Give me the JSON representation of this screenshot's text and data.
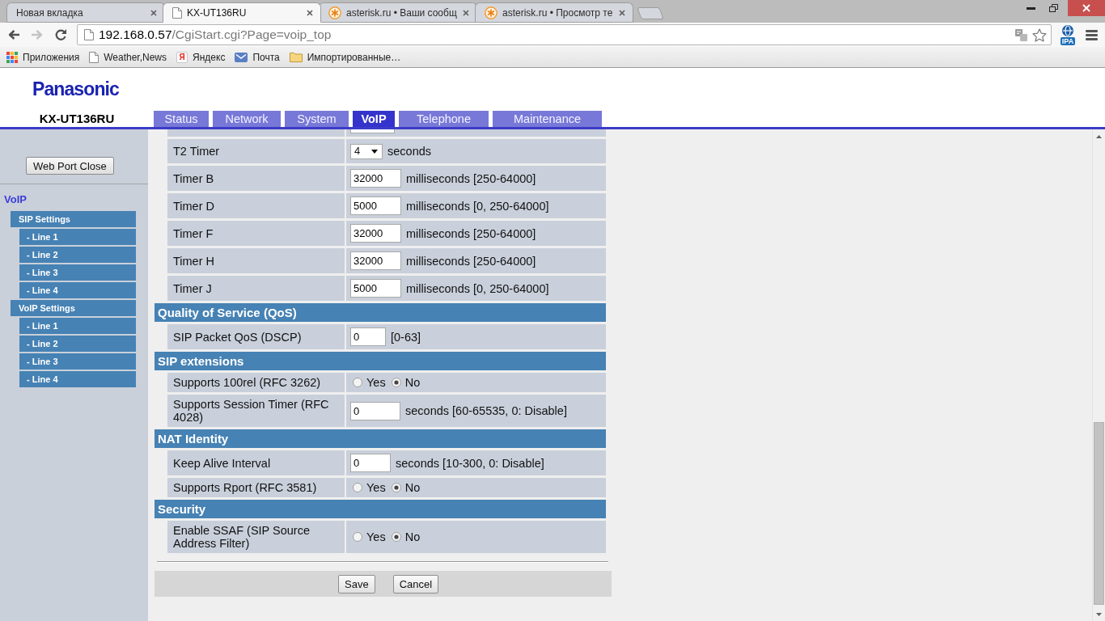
{
  "browser": {
    "tabs": [
      {
        "title": "Новая вкладка",
        "selected": false
      },
      {
        "title": "KX-UT136RU",
        "selected": true
      },
      {
        "title": "asterisk.ru • Ваши сообщ",
        "selected": false
      },
      {
        "title": "asterisk.ru • Просмотр те",
        "selected": false
      }
    ],
    "nav": [
      {
        "kind": "back",
        "disabled": false
      },
      {
        "kind": "forward",
        "disabled": true
      },
      {
        "kind": "reload",
        "disabled": false
      }
    ],
    "address": {
      "host": "192.168.0.57",
      "path": "/CgiStart.cgi?Page=voip_top"
    },
    "extension": {
      "label": "IPA"
    },
    "bookmarks": [
      {
        "label": "Приложения"
      },
      {
        "label": "Weather,News"
      },
      {
        "label": "Яндекс",
        "glyph": "Я"
      },
      {
        "label": "Почта"
      },
      {
        "label": "Импортированные…"
      }
    ]
  },
  "header": {
    "logo": "Panasonic",
    "model": "KX-UT136RU",
    "tabs": [
      {
        "label": "Status",
        "selected": false
      },
      {
        "label": "Network",
        "selected": false
      },
      {
        "label": "System",
        "selected": false
      },
      {
        "label": "VoIP",
        "selected": true
      },
      {
        "label": "Telephone",
        "selected": false
      },
      {
        "label": "Maintenance",
        "selected": false
      }
    ]
  },
  "sidebar": {
    "button": "Web Port Close",
    "title": "VoIP",
    "items": [
      {
        "label": "SIP Settings",
        "children": [
          {
            "label": "- Line 1"
          },
          {
            "label": "- Line 2"
          },
          {
            "label": "- Line 3"
          },
          {
            "label": "- Line 4"
          }
        ]
      },
      {
        "label": "VoIP Settings",
        "children": [
          {
            "label": "- Line 1"
          },
          {
            "label": "- Line 2"
          },
          {
            "label": "- Line 3"
          },
          {
            "label": "- Line 4"
          }
        ]
      }
    ]
  },
  "form": {
    "rows": [
      {
        "kind": "clipped"
      },
      {
        "kind": "select",
        "label": "T2 Timer",
        "value": "4",
        "unit": "seconds"
      },
      {
        "kind": "input",
        "label": "Timer B",
        "value": "32000",
        "unit": "milliseconds [250-64000]"
      },
      {
        "kind": "input",
        "label": "Timer D",
        "value": "5000",
        "unit": "milliseconds [0, 250-64000]"
      },
      {
        "kind": "input",
        "label": "Timer F",
        "value": "32000",
        "unit": "milliseconds [250-64000]"
      },
      {
        "kind": "input",
        "label": "Timer H",
        "value": "32000",
        "unit": "milliseconds [250-64000]"
      },
      {
        "kind": "input",
        "label": "Timer J",
        "value": "5000",
        "unit": "milliseconds [0, 250-64000]"
      },
      {
        "kind": "section",
        "title": "Quality of Service (QoS)"
      },
      {
        "kind": "input",
        "label": "SIP Packet QoS (DSCP)",
        "value": "0",
        "unit": "[0-63]"
      },
      {
        "kind": "section",
        "title": "SIP extensions"
      },
      {
        "kind": "radio",
        "label": "Supports 100rel (RFC 3262)",
        "options": [
          {
            "label": "Yes",
            "selected": false
          },
          {
            "label": "No",
            "selected": true
          }
        ]
      },
      {
        "kind": "input",
        "label": "Supports Session Timer (RFC 4028)",
        "value": "0",
        "unit": "seconds [60-65535, 0: Disable]"
      },
      {
        "kind": "section",
        "title": "NAT Identity"
      },
      {
        "kind": "input",
        "label": "Keep Alive Interval",
        "value": "0",
        "unit": "seconds [10-300, 0: Disable]"
      },
      {
        "kind": "radio",
        "label": "Supports Rport (RFC 3581)",
        "options": [
          {
            "label": "Yes",
            "selected": false
          },
          {
            "label": "No",
            "selected": true
          }
        ]
      },
      {
        "kind": "section",
        "title": "Security"
      },
      {
        "kind": "radio",
        "label": "Enable SSAF (SIP Source Address Filter)",
        "options": [
          {
            "label": "Yes",
            "selected": false
          },
          {
            "label": "No",
            "selected": true
          }
        ]
      }
    ],
    "buttons": [
      "Save",
      "Cancel"
    ]
  }
}
